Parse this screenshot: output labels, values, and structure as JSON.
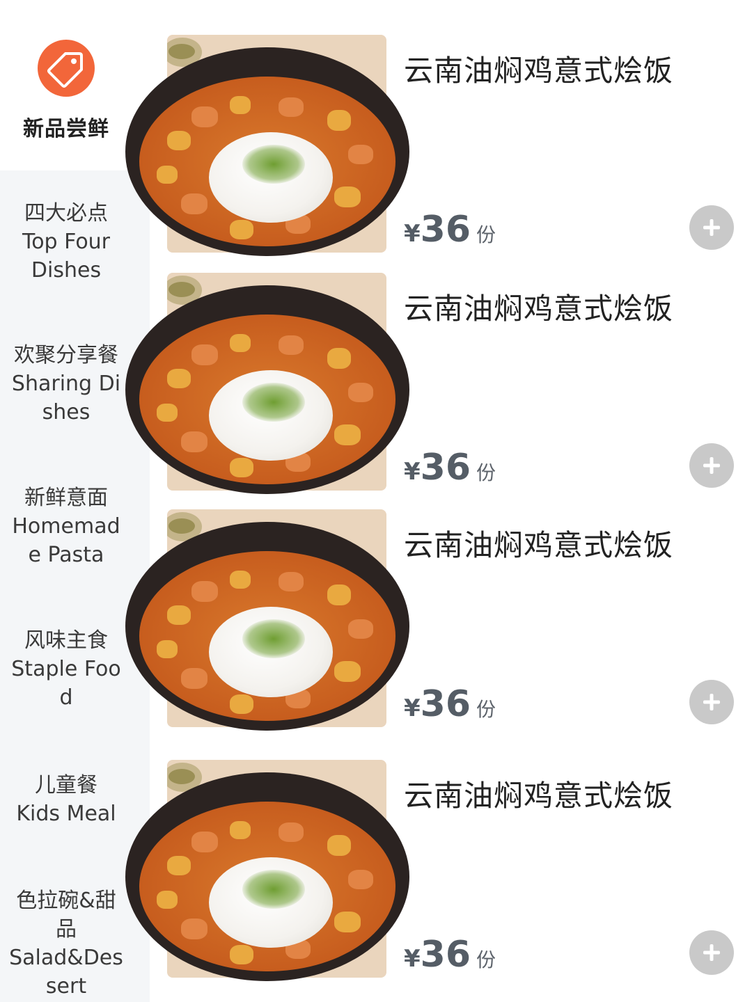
{
  "sidebar": {
    "active": {
      "icon": "price-tag-icon",
      "label": "新品尝鲜",
      "accent_color": "#f2663a"
    },
    "categories": [
      {
        "lines": [
          "四大必点",
          "Top Four",
          "Dishes"
        ]
      },
      {
        "lines": [
          "欢聚分享餐",
          "Sharing Di",
          "shes"
        ]
      },
      {
        "lines": [
          "新鲜意面",
          "Homemad",
          "e Pasta"
        ]
      },
      {
        "lines": [
          "风味主食",
          "Staple Foo",
          "d"
        ]
      },
      {
        "lines": [
          "儿童餐",
          "Kids Meal"
        ]
      },
      {
        "lines": [
          "色拉碗&甜",
          "品",
          "Salad&Des",
          "sert"
        ]
      }
    ]
  },
  "products": [
    {
      "name": "云南油焖鸡意式烩饭",
      "currency": "¥",
      "price": "36",
      "unit": "份",
      "add_icon": "plus-icon"
    },
    {
      "name": "云南油焖鸡意式烩饭",
      "currency": "¥",
      "price": "36",
      "unit": "份",
      "add_icon": "plus-icon"
    },
    {
      "name": "云南油焖鸡意式烩饭",
      "currency": "¥",
      "price": "36",
      "unit": "份",
      "add_icon": "plus-icon"
    },
    {
      "name": "云南油焖鸡意式烩饭",
      "currency": "¥",
      "price": "36",
      "unit": "份",
      "add_icon": "plus-icon"
    }
  ]
}
